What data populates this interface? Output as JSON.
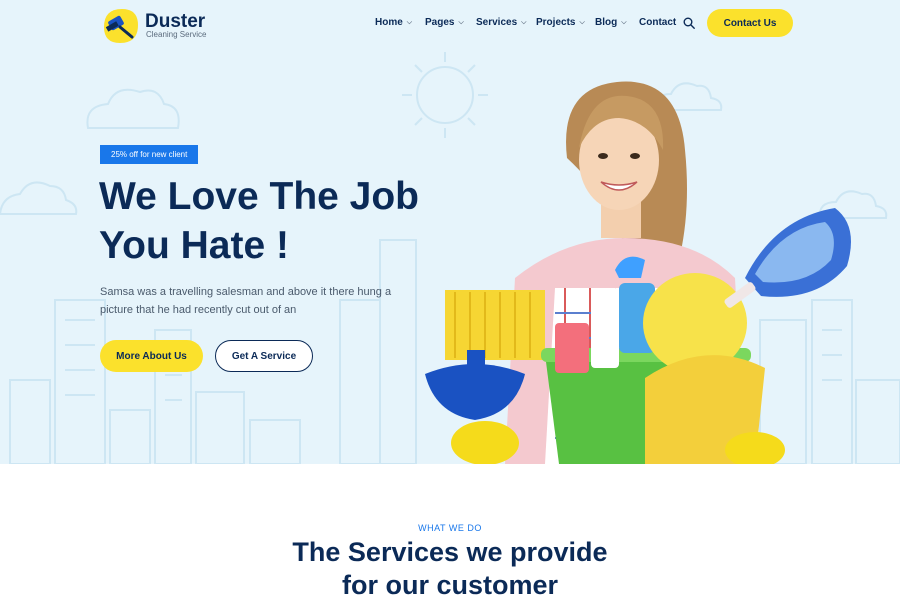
{
  "brand": {
    "name": "Duster",
    "tagline": "Cleaning Service"
  },
  "nav": {
    "items": [
      {
        "label": "Home",
        "dropdown": true
      },
      {
        "label": "Pages",
        "dropdown": true
      },
      {
        "label": "Services",
        "dropdown": true
      },
      {
        "label": "Projects",
        "dropdown": true
      },
      {
        "label": "Blog",
        "dropdown": true
      },
      {
        "label": "Contact",
        "dropdown": false
      }
    ],
    "search_icon": "search-icon",
    "cta_label": "Contact Us"
  },
  "hero": {
    "badge": "25% off for new client",
    "title_line1": "We Love The Job",
    "title_line2": "You Hate !",
    "text_line1": "Samsa was a travelling salesman and above it there hung a",
    "text_line2": "picture that he had recently cut out of an",
    "primary_button": "More About Us",
    "secondary_button": "Get A Service"
  },
  "services": {
    "eyebrow": "WHAT WE DO",
    "title_line1": "The Services we provide",
    "title_line2": "for our customer"
  },
  "colors": {
    "accent_yellow": "#fbe12c",
    "primary_blue": "#1977ea",
    "navy": "#0b2a57",
    "hero_bg": "#e6f4fb"
  }
}
